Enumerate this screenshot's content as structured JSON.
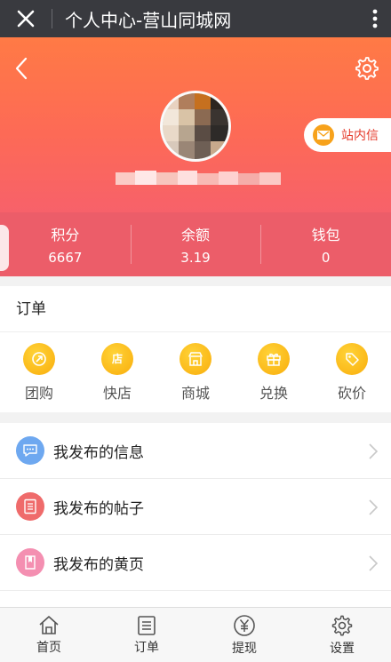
{
  "window": {
    "title": "个人中心-营山同城网"
  },
  "header": {
    "message_button_label": "站内信"
  },
  "stats": [
    {
      "label": "积分",
      "value": "6667"
    },
    {
      "label": "余额",
      "value": "3.19"
    },
    {
      "label": "钱包",
      "value": "0"
    }
  ],
  "orders": {
    "title": "订单",
    "items": [
      {
        "label": "团购",
        "icon": "group-buy-icon"
      },
      {
        "label": "快店",
        "icon": "shop-icon",
        "glyph": "店"
      },
      {
        "label": "商城",
        "icon": "mall-icon"
      },
      {
        "label": "兑换",
        "icon": "gift-icon"
      },
      {
        "label": "砍价",
        "icon": "tag-icon"
      }
    ]
  },
  "menu": [
    {
      "label": "我发布的信息",
      "icon": "chat-bubble-icon",
      "color": "#6ea8f0"
    },
    {
      "label": "我发布的帖子",
      "icon": "document-icon",
      "color": "#ef6b6b"
    },
    {
      "label": "我发布的黄页",
      "icon": "book-icon",
      "color": "#f48fb1"
    }
  ],
  "tabbar": [
    {
      "label": "首页",
      "icon": "home-icon"
    },
    {
      "label": "订单",
      "icon": "order-list-icon"
    },
    {
      "label": "提现",
      "icon": "yuan-icon"
    },
    {
      "label": "设置",
      "icon": "settings-icon"
    }
  ],
  "colors": {
    "title_bar": "#393a3f",
    "hero_top": "#ff7a45",
    "hero_bottom": "#f7616a",
    "stats_bar": "#ec5d69",
    "order_icon": "#f9ad0b",
    "message_text": "#e53b2c"
  }
}
